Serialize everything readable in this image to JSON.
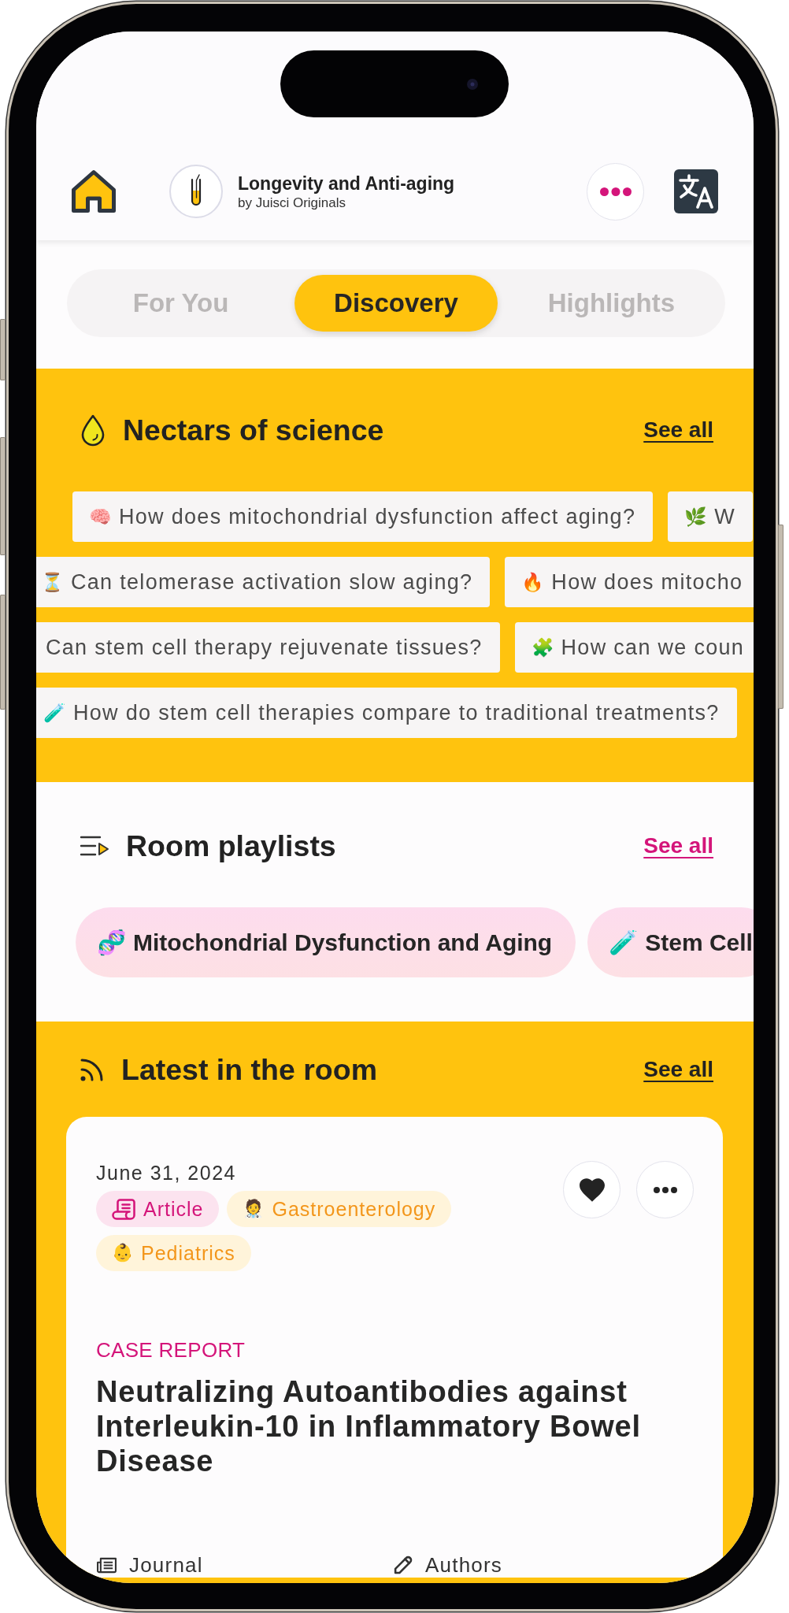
{
  "header": {
    "title": "Longevity and Anti-aging",
    "subtitle": "by Juisci Originals"
  },
  "tabs": [
    {
      "label": "For You",
      "selected": false
    },
    {
      "label": "Discovery",
      "selected": true
    },
    {
      "label": "Highlights",
      "selected": false
    }
  ],
  "nectars": {
    "title": "Nectars of science",
    "see_all": "See all",
    "rows": [
      [
        {
          "emoji": "🧠",
          "text": "How does mitochondrial dysfunction affect aging?"
        },
        {
          "emoji": "🌿",
          "text": "W"
        }
      ],
      [
        {
          "emoji": "⏳",
          "text": "Can telomerase activation slow aging?"
        },
        {
          "emoji": "🔥",
          "text": "How does mitocho"
        }
      ],
      [
        {
          "text": "Can stem cell therapy rejuvenate tissues?"
        },
        {
          "emoji": "🧩",
          "text": "How can we coun"
        }
      ],
      [
        {
          "emoji": "🧪",
          "text": "How do stem cell therapies compare to traditional treatments?"
        }
      ]
    ]
  },
  "playlists": {
    "title": "Room playlists",
    "see_all": "See all",
    "items": [
      {
        "emoji": "🧬",
        "text": "Mitochondrial Dysfunction and Aging"
      },
      {
        "emoji": "🧪",
        "text": "Stem Cell"
      }
    ]
  },
  "latest": {
    "title": "Latest in the room",
    "see_all": "See all",
    "card": {
      "date": "June 31, 2024",
      "tags": [
        {
          "kind": "type",
          "label": "Article"
        },
        {
          "kind": "specialty",
          "emoji": "🧑‍⚕️",
          "label": "Gastroenterology"
        },
        {
          "kind": "specialty",
          "emoji": "👶",
          "label": "Pediatrics"
        }
      ],
      "category": "CASE REPORT",
      "title": "Neutralizing Autoantibodies against Interleukin-10 in Inflammatory Bowel Disease",
      "meta": [
        {
          "kind": "journal",
          "label": "Journal"
        },
        {
          "kind": "authors",
          "label": "Authors"
        }
      ]
    }
  }
}
